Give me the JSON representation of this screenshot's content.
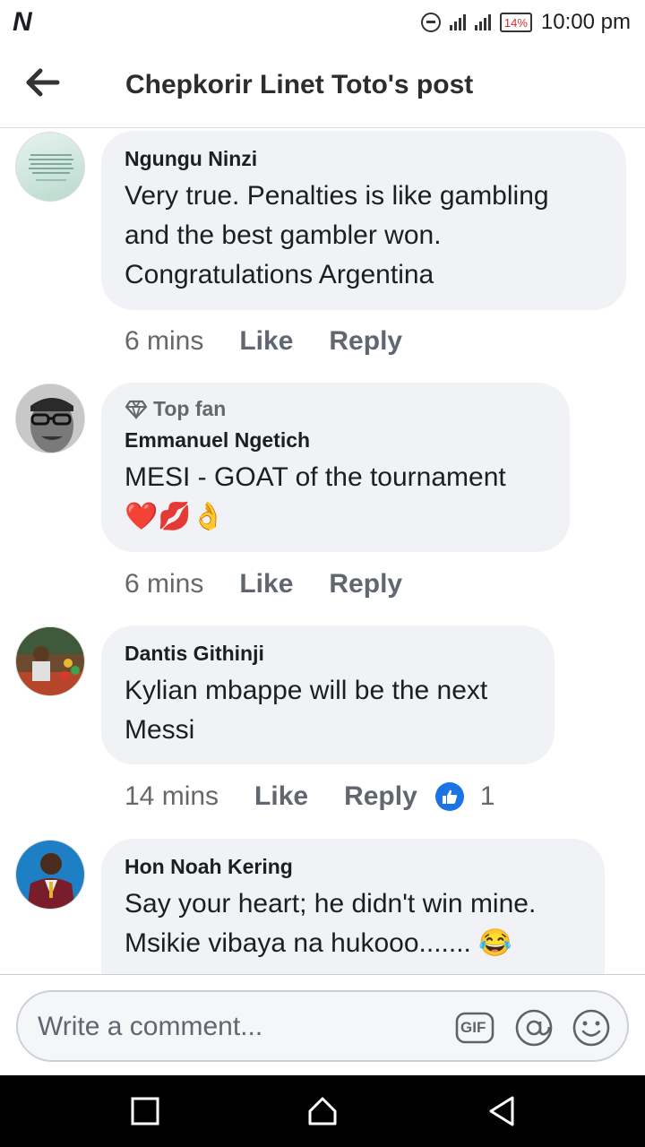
{
  "status_bar": {
    "app_logo": "N",
    "battery": "14%",
    "time": "10:00 pm"
  },
  "header": {
    "title": "Chepkorir Linet Toto's post"
  },
  "comments": [
    {
      "author": "Ngungu Ninzi",
      "lines": [
        "Very true. Penalties is like gambling",
        "and the best gambler won.",
        "Congratulations Argentina"
      ],
      "time": "6 mins",
      "like": "Like",
      "reply": "Reply"
    },
    {
      "badge": "Top fan",
      "author": "Emmanuel Ngetich",
      "lines": [
        "MESI - GOAT of the tournament"
      ],
      "emojis": "❤️💋👌",
      "time": "6 mins",
      "like": "Like",
      "reply": "Reply"
    },
    {
      "author": "Dantis Githinji",
      "lines": [
        "Kylian mbappe will be the next",
        "Messi"
      ],
      "time": "14 mins",
      "like": "Like",
      "reply": "Reply",
      "reaction_count": "1"
    },
    {
      "author": "Hon Noah Kering",
      "lines": [
        "Say your heart; he didn't win mine.",
        "Msikie vibaya na hukooo......."
      ],
      "emojis": "😂"
    }
  ],
  "composer": {
    "placeholder": "Write a comment...",
    "gif_label": "GIF"
  },
  "colors": {
    "bubble": "#f0f2f5",
    "like_blue": "#1b74e4",
    "secondary_text": "#65676b"
  },
  "icons": [
    "back-arrow-icon",
    "diamond-icon",
    "thumbs-up-icon",
    "gif-icon",
    "mention-icon",
    "emoji-icon",
    "square-icon",
    "home-icon",
    "triangle-back-icon"
  ]
}
